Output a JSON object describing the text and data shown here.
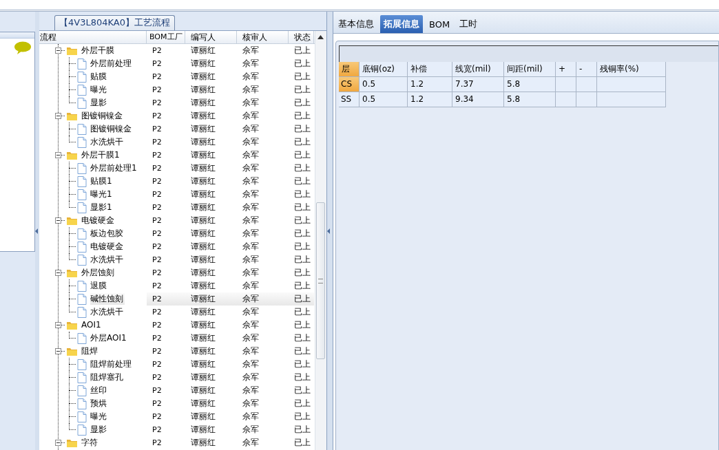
{
  "group_title": "【4V3L804KA0】工艺流程",
  "tree_columns": [
    "流程",
    "BOM工厂",
    "编写人",
    "核审人",
    "状态"
  ],
  "tree": [
    {
      "label": "外层干膜",
      "bom": "P2",
      "writer": "谭丽红",
      "reviewer": "佘军",
      "status": "已上",
      "expanded": true,
      "selected": false,
      "children": [
        {
          "label": "外层前处理",
          "bom": "P2",
          "writer": "谭丽红",
          "reviewer": "佘军",
          "status": "已上",
          "selected": false
        },
        {
          "label": "贴膜",
          "bom": "P2",
          "writer": "谭丽红",
          "reviewer": "佘军",
          "status": "已上",
          "selected": false
        },
        {
          "label": "曝光",
          "bom": "P2",
          "writer": "谭丽红",
          "reviewer": "佘军",
          "status": "已上",
          "selected": false
        },
        {
          "label": "显影",
          "bom": "P2",
          "writer": "谭丽红",
          "reviewer": "佘军",
          "status": "已上",
          "selected": false
        }
      ]
    },
    {
      "label": "图镀铜镍金",
      "bom": "P2",
      "writer": "谭丽红",
      "reviewer": "佘军",
      "status": "已上",
      "expanded": true,
      "selected": false,
      "children": [
        {
          "label": "图镀铜镍金",
          "bom": "P2",
          "writer": "谭丽红",
          "reviewer": "佘军",
          "status": "已上",
          "selected": false
        },
        {
          "label": "水洗烘干",
          "bom": "P2",
          "writer": "谭丽红",
          "reviewer": "佘军",
          "status": "已上",
          "selected": false
        }
      ]
    },
    {
      "label": "外层干膜1",
      "bom": "P2",
      "writer": "谭丽红",
      "reviewer": "佘军",
      "status": "已上",
      "expanded": true,
      "selected": false,
      "children": [
        {
          "label": "外层前处理1",
          "bom": "P2",
          "writer": "谭丽红",
          "reviewer": "佘军",
          "status": "已上",
          "selected": false
        },
        {
          "label": "贴膜1",
          "bom": "P2",
          "writer": "谭丽红",
          "reviewer": "佘军",
          "status": "已上",
          "selected": false
        },
        {
          "label": "曝光1",
          "bom": "P2",
          "writer": "谭丽红",
          "reviewer": "佘军",
          "status": "已上",
          "selected": false
        },
        {
          "label": "显影1",
          "bom": "P2",
          "writer": "谭丽红",
          "reviewer": "佘军",
          "status": "已上",
          "selected": false
        }
      ]
    },
    {
      "label": "电镀硬金",
      "bom": "P2",
      "writer": "谭丽红",
      "reviewer": "佘军",
      "status": "已上",
      "expanded": true,
      "selected": false,
      "children": [
        {
          "label": "板边包胶",
          "bom": "P2",
          "writer": "谭丽红",
          "reviewer": "佘军",
          "status": "已上",
          "selected": false
        },
        {
          "label": "电镀硬金",
          "bom": "P2",
          "writer": "谭丽红",
          "reviewer": "佘军",
          "status": "已上",
          "selected": false
        },
        {
          "label": "水洗烘干",
          "bom": "P2",
          "writer": "谭丽红",
          "reviewer": "佘军",
          "status": "已上",
          "selected": false
        }
      ]
    },
    {
      "label": "外层蚀刻",
      "bom": "P2",
      "writer": "谭丽红",
      "reviewer": "佘军",
      "status": "已上",
      "expanded": true,
      "selected": false,
      "children": [
        {
          "label": "退膜",
          "bom": "P2",
          "writer": "谭丽红",
          "reviewer": "佘军",
          "status": "已上",
          "selected": false
        },
        {
          "label": "碱性蚀刻",
          "bom": "P2",
          "writer": "谭丽红",
          "reviewer": "佘军",
          "status": "已上",
          "selected": true
        },
        {
          "label": "水洗烘干",
          "bom": "P2",
          "writer": "谭丽红",
          "reviewer": "佘军",
          "status": "已上",
          "selected": false
        }
      ]
    },
    {
      "label": "AOI1",
      "bom": "P2",
      "writer": "谭丽红",
      "reviewer": "佘军",
      "status": "已上",
      "expanded": true,
      "selected": false,
      "children": [
        {
          "label": "外层AOI1",
          "bom": "P2",
          "writer": "谭丽红",
          "reviewer": "佘军",
          "status": "已上",
          "selected": false
        }
      ]
    },
    {
      "label": "阻焊",
      "bom": "P2",
      "writer": "谭丽红",
      "reviewer": "佘军",
      "status": "已上",
      "expanded": true,
      "selected": false,
      "children": [
        {
          "label": "阻焊前处理",
          "bom": "P2",
          "writer": "谭丽红",
          "reviewer": "佘军",
          "status": "已上",
          "selected": false
        },
        {
          "label": "阻焊塞孔",
          "bom": "P2",
          "writer": "谭丽红",
          "reviewer": "佘军",
          "status": "已上",
          "selected": false
        },
        {
          "label": "丝印",
          "bom": "P2",
          "writer": "谭丽红",
          "reviewer": "佘军",
          "status": "已上",
          "selected": false
        },
        {
          "label": "预烘",
          "bom": "P2",
          "writer": "谭丽红",
          "reviewer": "佘军",
          "status": "已上",
          "selected": false
        },
        {
          "label": "曝光",
          "bom": "P2",
          "writer": "谭丽红",
          "reviewer": "佘军",
          "status": "已上",
          "selected": false
        },
        {
          "label": "显影",
          "bom": "P2",
          "writer": "谭丽红",
          "reviewer": "佘军",
          "status": "已上",
          "selected": false
        }
      ]
    },
    {
      "label": "字符",
      "bom": "P2",
      "writer": "谭丽红",
      "reviewer": "佘军",
      "status": "已上",
      "expanded": true,
      "selected": false
    }
  ],
  "tabs": [
    {
      "label": "基本信息",
      "selected": false
    },
    {
      "label": "拓展信息",
      "selected": true
    },
    {
      "label": "BOM",
      "selected": false
    },
    {
      "label": "工时",
      "selected": false
    }
  ],
  "layer_table": {
    "columns": [
      "层",
      "底铜(oz)",
      "补偿",
      "线宽(mil)",
      "间距(mil)",
      "+",
      "-",
      "残铜率(%)"
    ],
    "rows": [
      {
        "selected": true,
        "cells": [
          "CS",
          "0.5",
          "1.2",
          "7.37",
          "5.8"
        ]
      },
      {
        "selected": false,
        "cells": [
          "SS",
          "0.5",
          "1.2",
          "9.34",
          "5.8"
        ]
      }
    ]
  }
}
